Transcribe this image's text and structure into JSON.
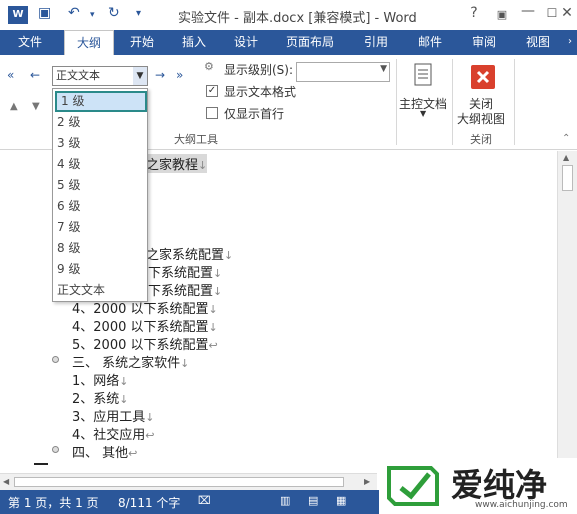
{
  "window": {
    "title": "实验文件 - 副本.docx [兼容模式] - Word",
    "help": "?",
    "min": "—",
    "max": "☐",
    "close": "✕"
  },
  "quick_access": {
    "save": "💾",
    "undo": "↶",
    "redo": "↻",
    "customize": "⌄"
  },
  "tabs": [
    {
      "label": "文件"
    },
    {
      "label": "大纲"
    },
    {
      "label": "开始"
    },
    {
      "label": "插入"
    },
    {
      "label": "设计"
    },
    {
      "label": "页面布局"
    },
    {
      "label": "引用"
    },
    {
      "label": "邮件"
    },
    {
      "label": "审阅"
    },
    {
      "label": "视图"
    }
  ],
  "ribbon": {
    "level_combo": "正文文本",
    "show_level_label": "显示级别(S):",
    "show_text_format": "显示文本格式",
    "show_text_format_checked": true,
    "show_first_line": "仅显示首行",
    "show_first_line_checked": false,
    "group_outline_tools": "大纲工具",
    "master_doc": "主控文档",
    "close_label_1": "关闭",
    "close_label_2": "大纲视图",
    "group_close": "关闭"
  },
  "dropdown": {
    "items": [
      "1 级",
      "2 级",
      "3 级",
      "4 级",
      "5 级",
      "6 级",
      "7 级",
      "8 级",
      "9 级",
      "正文文本"
    ],
    "selected_index": 0
  },
  "document": {
    "lines": [
      {
        "text": "之家教程",
        "mark": "↓"
      },
      {
        "text": "之家系统配置",
        "mark": "↓"
      },
      {
        "text": "下系统配置",
        "mark": "↓"
      },
      {
        "text": "下系统配置",
        "mark": "↓"
      },
      {
        "text": "4、2000 以下系统配置",
        "mark": "↓"
      },
      {
        "text": "4、2000 以下系统配置",
        "mark": "↓"
      },
      {
        "text": "5、2000 以下系统配置",
        "mark": "↩"
      },
      {
        "text": "三、    系统之家软件",
        "mark": "↓"
      },
      {
        "text": "1、网络",
        "mark": "↓"
      },
      {
        "text": "2、系统",
        "mark": "↓"
      },
      {
        "text": "3、应用工具",
        "mark": "↓"
      },
      {
        "text": "4、社交应用",
        "mark": "↩"
      },
      {
        "text": "四、    其他",
        "mark": "↩"
      }
    ]
  },
  "status": {
    "page": "第 1 页，共 1 页",
    "words": "8/111 个字"
  },
  "watermark": {
    "text": "爱纯净",
    "url": "www.aichunjing.com"
  }
}
